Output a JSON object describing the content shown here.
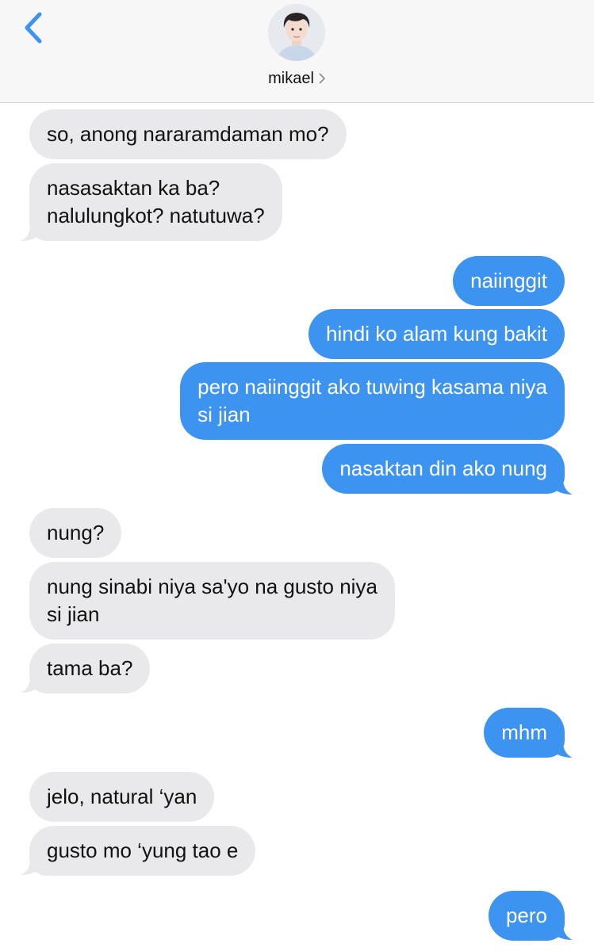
{
  "header": {
    "contact_name": "mikael",
    "back_icon": "chevron-left-icon",
    "accent": "#3d94f0"
  },
  "messages": [
    {
      "from": "them",
      "text": "so, anong nararamdaman mo?"
    },
    {
      "from": "them",
      "lines": [
        "nasasaktan ka ba?",
        "nalulungkot? natutuwa?"
      ]
    },
    {
      "from": "me",
      "text": "naiinggit"
    },
    {
      "from": "me",
      "text": "hindi ko alam kung bakit"
    },
    {
      "from": "me",
      "lines": [
        "pero naiinggit ako tuwing kasama niya",
        "si jian"
      ]
    },
    {
      "from": "me",
      "text": "nasaktan din ako nung"
    },
    {
      "from": "them",
      "text": "nung?"
    },
    {
      "from": "them",
      "lines": [
        "nung sinabi niya sa'yo na gusto niya",
        "si jian"
      ]
    },
    {
      "from": "them",
      "text": "tama ba?"
    },
    {
      "from": "me",
      "text": "mhm"
    },
    {
      "from": "them",
      "text": "jelo, natural ‘yan"
    },
    {
      "from": "them",
      "text": "gusto mo ‘yung tao e"
    },
    {
      "from": "me",
      "text": "pero"
    }
  ],
  "colors": {
    "incoming_bubble": "#e9e9eb",
    "outgoing_bubble": "#3d94f0"
  }
}
